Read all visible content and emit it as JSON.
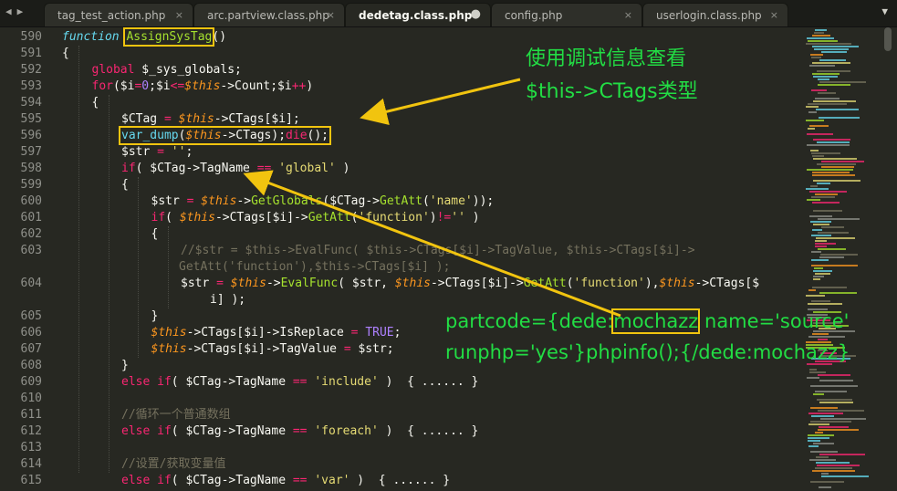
{
  "tabs": [
    {
      "label": "tag_test_action.php",
      "active": false
    },
    {
      "label": "arc.partview.class.php",
      "active": false
    },
    {
      "label": "dedetag.class.php",
      "active": true
    },
    {
      "label": "config.php",
      "active": false
    },
    {
      "label": "userlogin.class.php",
      "active": false
    }
  ],
  "tab_close_glyph": "×",
  "tab_dirty_glyph": "●",
  "nav_arrows": "◀▶",
  "tab_dropdown": "▼",
  "line_numbers": [
    "590",
    "591",
    "592",
    "593",
    "594",
    "595",
    "596",
    "597",
    "598",
    "599",
    "600",
    "601",
    "602",
    "603",
    "604",
    "605",
    "606",
    "607",
    "608",
    "609",
    "610",
    "611",
    "612",
    "613",
    "614",
    "615"
  ],
  "code_lines": [
    {
      "indent": 1,
      "tokens": [
        {
          "t": "function",
          "c": "kf"
        },
        {
          "t": " "
        },
        {
          "t": "AssignSysTag",
          "c": "g",
          "hl": true
        },
        {
          "t": "()"
        }
      ]
    },
    {
      "indent": 1,
      "tokens": [
        {
          "t": "{"
        }
      ]
    },
    {
      "indent": 2,
      "tokens": [
        {
          "t": "global",
          "c": "k"
        },
        {
          "t": " $_sys_globals;"
        }
      ]
    },
    {
      "indent": 2,
      "tokens": [
        {
          "t": "for",
          "c": "k"
        },
        {
          "t": "($i"
        },
        {
          "t": "=",
          "c": "k"
        },
        {
          "t": "0",
          "c": "n"
        },
        {
          "t": ";$i"
        },
        {
          "t": "<=",
          "c": "k"
        },
        {
          "t": "$this",
          "c": "v"
        },
        {
          "t": "->Count;$i"
        },
        {
          "t": "++",
          "c": "k"
        },
        {
          "t": ")"
        }
      ]
    },
    {
      "indent": 2,
      "tokens": [
        {
          "t": "{"
        }
      ]
    },
    {
      "indent": 3,
      "tokens": [
        {
          "t": "$CTag "
        },
        {
          "t": "=",
          "c": "k"
        },
        {
          "t": " "
        },
        {
          "t": "$this",
          "c": "v"
        },
        {
          "t": "->CTags[$i];"
        }
      ]
    },
    {
      "indent": 3,
      "boxed": true,
      "tokens": [
        {
          "t": "var_dump",
          "c": "b"
        },
        {
          "t": "("
        },
        {
          "t": "$this",
          "c": "v"
        },
        {
          "t": "->CTags);"
        },
        {
          "t": "die",
          "c": "k"
        },
        {
          "t": "();"
        }
      ]
    },
    {
      "indent": 3,
      "tokens": [
        {
          "t": "$str "
        },
        {
          "t": "=",
          "c": "k"
        },
        {
          "t": " "
        },
        {
          "t": "''",
          "c": "s"
        },
        {
          "t": ";"
        }
      ]
    },
    {
      "indent": 3,
      "tokens": [
        {
          "t": "if",
          "c": "k"
        },
        {
          "t": "( $CTag->TagName "
        },
        {
          "t": "==",
          "c": "k"
        },
        {
          "t": " "
        },
        {
          "t": "'global'",
          "c": "s"
        },
        {
          "t": " )"
        }
      ]
    },
    {
      "indent": 3,
      "tokens": [
        {
          "t": "{"
        }
      ]
    },
    {
      "indent": 4,
      "tokens": [
        {
          "t": "$str "
        },
        {
          "t": "=",
          "c": "k"
        },
        {
          "t": " "
        },
        {
          "t": "$this",
          "c": "v"
        },
        {
          "t": "->"
        },
        {
          "t": "GetGlobals",
          "c": "g"
        },
        {
          "t": "($CTag->"
        },
        {
          "t": "GetAtt",
          "c": "g"
        },
        {
          "t": "("
        },
        {
          "t": "'name'",
          "c": "s"
        },
        {
          "t": "));"
        }
      ]
    },
    {
      "indent": 4,
      "tokens": [
        {
          "t": "if",
          "c": "k"
        },
        {
          "t": "( "
        },
        {
          "t": "$this",
          "c": "v"
        },
        {
          "t": "->CTags[$i]->"
        },
        {
          "t": "GetAtt",
          "c": "g"
        },
        {
          "t": "("
        },
        {
          "t": "'function'",
          "c": "s"
        },
        {
          "t": ")"
        },
        {
          "t": "!=",
          "c": "k"
        },
        {
          "t": ""
        },
        {
          "t": "''",
          "c": "s"
        },
        {
          "t": " )"
        }
      ]
    },
    {
      "indent": 4,
      "tokens": [
        {
          "t": "{"
        }
      ]
    },
    {
      "indent": 5,
      "tokens": [
        {
          "t": "//$str = $this->EvalFunc( $this->CTags[$i]->TagValue, $this->CTags[$i]->",
          "c": "c"
        }
      ]
    },
    {
      "indent": 5,
      "cont": true,
      "tokens": [
        {
          "t": "GetAtt('function'),$this->CTags[$i] );",
          "c": "c"
        }
      ]
    },
    {
      "indent": 5,
      "tokens": [
        {
          "t": "$str "
        },
        {
          "t": "=",
          "c": "k"
        },
        {
          "t": " "
        },
        {
          "t": "$this",
          "c": "v"
        },
        {
          "t": "->"
        },
        {
          "t": "EvalFunc",
          "c": "g"
        },
        {
          "t": "( $str, "
        },
        {
          "t": "$this",
          "c": "v"
        },
        {
          "t": "->CTags[$i]->"
        },
        {
          "t": "GetAtt",
          "c": "g"
        },
        {
          "t": "("
        },
        {
          "t": "'function'",
          "c": "s"
        },
        {
          "t": "),"
        },
        {
          "t": "$this",
          "c": "v"
        },
        {
          "t": "->CTags[$"
        }
      ]
    },
    {
      "indent": 5,
      "wrap": true,
      "tokens": [
        {
          "t": "i] );"
        }
      ]
    },
    {
      "indent": 4,
      "tokens": [
        {
          "t": "}"
        }
      ]
    },
    {
      "indent": 4,
      "tokens": [
        {
          "t": "$this",
          "c": "v"
        },
        {
          "t": "->CTags[$i]->IsReplace "
        },
        {
          "t": "=",
          "c": "k"
        },
        {
          "t": " "
        },
        {
          "t": "TRUE",
          "c": "n"
        },
        {
          "t": ";"
        }
      ]
    },
    {
      "indent": 4,
      "tokens": [
        {
          "t": "$this",
          "c": "v"
        },
        {
          "t": "->CTags[$i]->TagValue "
        },
        {
          "t": "=",
          "c": "k"
        },
        {
          "t": " $str;"
        }
      ]
    },
    {
      "indent": 3,
      "tokens": [
        {
          "t": "}"
        }
      ]
    },
    {
      "indent": 3,
      "tokens": [
        {
          "t": "else",
          "c": "k"
        },
        {
          "t": " "
        },
        {
          "t": "if",
          "c": "k"
        },
        {
          "t": "( $CTag->TagName "
        },
        {
          "t": "==",
          "c": "k"
        },
        {
          "t": " "
        },
        {
          "t": "'include'",
          "c": "s"
        },
        {
          "t": " )  { ...... }"
        }
      ]
    },
    {
      "indent": 3,
      "tokens": [
        {
          "t": ""
        }
      ]
    },
    {
      "indent": 3,
      "tokens": [
        {
          "t": "//循环一个普通数组",
          "c": "c"
        }
      ]
    },
    {
      "indent": 3,
      "tokens": [
        {
          "t": "else",
          "c": "k"
        },
        {
          "t": " "
        },
        {
          "t": "if",
          "c": "k"
        },
        {
          "t": "( $CTag->TagName "
        },
        {
          "t": "==",
          "c": "k"
        },
        {
          "t": " "
        },
        {
          "t": "'foreach'",
          "c": "s"
        },
        {
          "t": " )  { ...... }"
        }
      ]
    },
    {
      "indent": 3,
      "tokens": [
        {
          "t": ""
        }
      ]
    },
    {
      "indent": 3,
      "tokens": [
        {
          "t": "//设置/获取变量值",
          "c": "c"
        }
      ]
    },
    {
      "indent": 3,
      "tokens": [
        {
          "t": "else",
          "c": "k"
        },
        {
          "t": " "
        },
        {
          "t": "if",
          "c": "k"
        },
        {
          "t": "( $CTag->TagName "
        },
        {
          "t": "==",
          "c": "k"
        },
        {
          "t": " "
        },
        {
          "t": "'var'",
          "c": "s"
        },
        {
          "t": " )  { ...... }"
        }
      ]
    }
  ],
  "annotations": {
    "top_line1": "使用调试信息查看",
    "top_line2": "$this->CTags类型",
    "bottom_line1_pre": "partcode={dede:",
    "bottom_line1_box": "mochazz",
    "bottom_line1_post": " name='source'",
    "bottom_line2": "runphp='yes'}phpinfo();{/dede:mochazz}"
  },
  "colors": {
    "editor_bg": "#272822",
    "annotation_text": "#22dd44",
    "highlight_box": "#f1c40f"
  }
}
